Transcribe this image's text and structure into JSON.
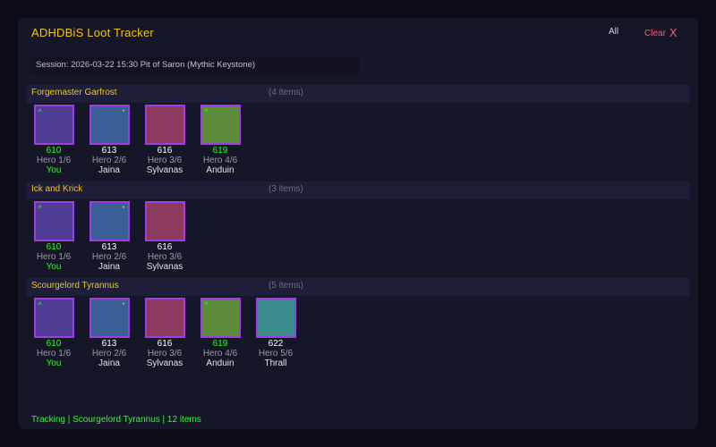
{
  "app": {
    "title": "ADHDBiS Loot Tracker",
    "all_label": "All",
    "clear_label": "Clear",
    "clear_icon": "X"
  },
  "session": "Session: 2026-03-22 15:30 Pit of Saron (Mythic Keystone)",
  "colors": {
    "accent": "#f2c41a",
    "upgrade": "#2aff2a",
    "item_border": "#a03ce6",
    "clear": "#ff5a6a"
  },
  "bosses": [
    {
      "name": "Forgemaster Garfrost",
      "count": "(4 items)",
      "items": [
        {
          "ilvl": "610",
          "difficulty": "Hero 1/6",
          "player": "You",
          "flag": "^",
          "upgrade": true,
          "me": true,
          "color": "#4f3d96"
        },
        {
          "ilvl": "613",
          "difficulty": "Hero 2/6",
          "player": "Jaina",
          "flag": "*",
          "upgrade": false,
          "me": false,
          "color": "#3a5e96"
        },
        {
          "ilvl": "616",
          "difficulty": "Hero 3/6",
          "player": "Sylvanas",
          "flag": "",
          "upgrade": false,
          "me": false,
          "color": "#8c3a5e"
        },
        {
          "ilvl": "619",
          "difficulty": "Hero 4/6",
          "player": "Anduin",
          "flag": "^",
          "upgrade": true,
          "me": false,
          "color": "#5c8c3a"
        }
      ]
    },
    {
      "name": "Ick and Krick",
      "count": "(3 items)",
      "items": [
        {
          "ilvl": "610",
          "difficulty": "Hero 1/6",
          "player": "You",
          "flag": "^",
          "upgrade": true,
          "me": true,
          "color": "#4f3d96"
        },
        {
          "ilvl": "613",
          "difficulty": "Hero 2/6",
          "player": "Jaina",
          "flag": "*",
          "upgrade": false,
          "me": false,
          "color": "#3a5e96"
        },
        {
          "ilvl": "616",
          "difficulty": "Hero 3/6",
          "player": "Sylvanas",
          "flag": "",
          "upgrade": false,
          "me": false,
          "color": "#8c3a5e"
        }
      ]
    },
    {
      "name": "Scourgelord Tyrannus",
      "count": "(5 items)",
      "items": [
        {
          "ilvl": "610",
          "difficulty": "Hero 1/6",
          "player": "You",
          "flag": "^",
          "upgrade": true,
          "me": true,
          "color": "#4f3d96"
        },
        {
          "ilvl": "613",
          "difficulty": "Hero 2/6",
          "player": "Jaina",
          "flag": "*",
          "upgrade": false,
          "me": false,
          "color": "#3a5e96"
        },
        {
          "ilvl": "616",
          "difficulty": "Hero 3/6",
          "player": "Sylvanas",
          "flag": "",
          "upgrade": false,
          "me": false,
          "color": "#8c3a5e"
        },
        {
          "ilvl": "619",
          "difficulty": "Hero 4/6",
          "player": "Anduin",
          "flag": "^",
          "upgrade": true,
          "me": false,
          "color": "#5c8c3a"
        },
        {
          "ilvl": "622",
          "difficulty": "Hero 5/6",
          "player": "Thrall",
          "flag": "",
          "upgrade": false,
          "me": false,
          "color": "#3a8c8c"
        }
      ]
    }
  ],
  "status": "Tracking | Scourgelord Tyrannus | 12 items"
}
